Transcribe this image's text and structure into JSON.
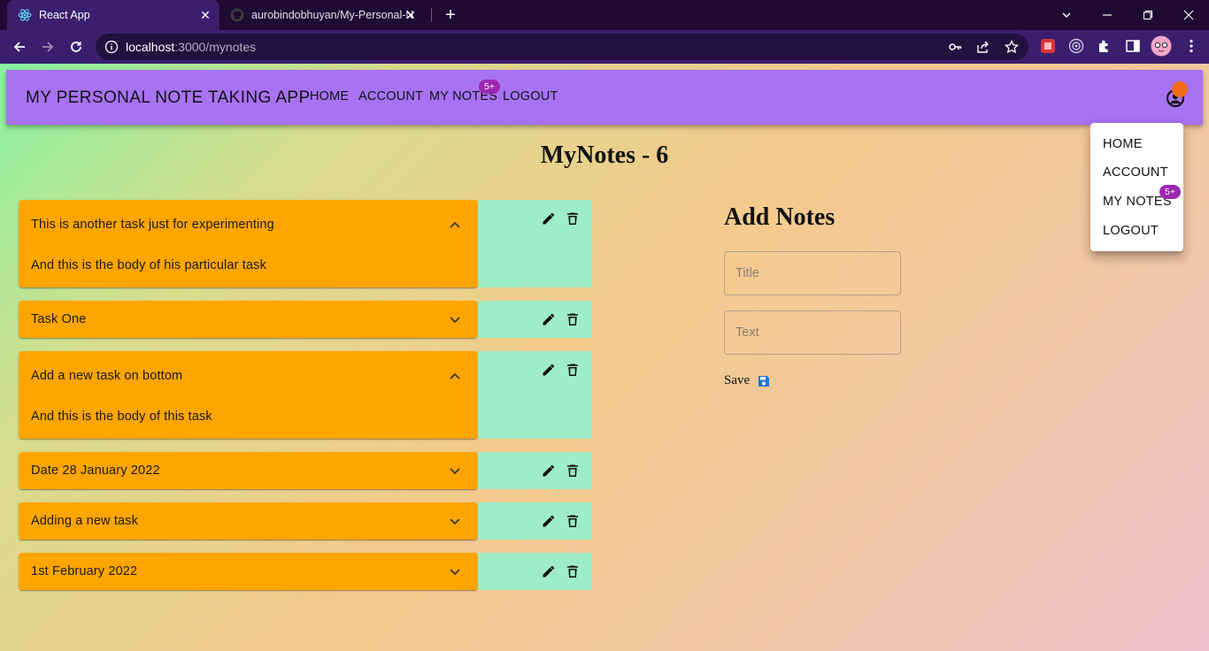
{
  "browser": {
    "tabs": [
      {
        "title": "React App",
        "active": true,
        "icon": "react-icon"
      },
      {
        "title": "aurobindobhuyan/My-Personal-N",
        "active": false,
        "icon": "github-icon"
      }
    ],
    "url_host": "localhost",
    "url_path": ":3000/mynotes"
  },
  "app": {
    "brand": "MY PERSONAL NOTE TAKING APP",
    "nav": {
      "home": "HOME",
      "account": "ACCOUNT",
      "mynotes": "MY NOTES",
      "logout": "LOGOUT"
    },
    "badge": "5+",
    "colors": {
      "appbar": "#a872f4",
      "note": "#ffa500",
      "actions": "#9eedc8",
      "badge": "#9c27b0",
      "avatar": "#f26b16"
    }
  },
  "page": {
    "title": "MyNotes - 6"
  },
  "notes": [
    {
      "title": "This is another task just for experimenting",
      "body": "And this is the body of his particular task",
      "expanded": true
    },
    {
      "title": "Task One",
      "body": "",
      "expanded": false
    },
    {
      "title": "Add a new task on bottom",
      "body": "And this is the body of this task",
      "expanded": true
    },
    {
      "title": "Date 28 January 2022",
      "body": "",
      "expanded": false
    },
    {
      "title": "Adding a new task",
      "body": "",
      "expanded": false
    },
    {
      "title": "1st February 2022",
      "body": "",
      "expanded": false
    }
  ],
  "form": {
    "heading": "Add Notes",
    "title_placeholder": "Title",
    "text_placeholder": "Text",
    "save_label": "Save"
  },
  "menu": {
    "items": [
      "HOME",
      "ACCOUNT",
      "MY NOTES",
      "LOGOUT"
    ],
    "badge": "5+"
  }
}
